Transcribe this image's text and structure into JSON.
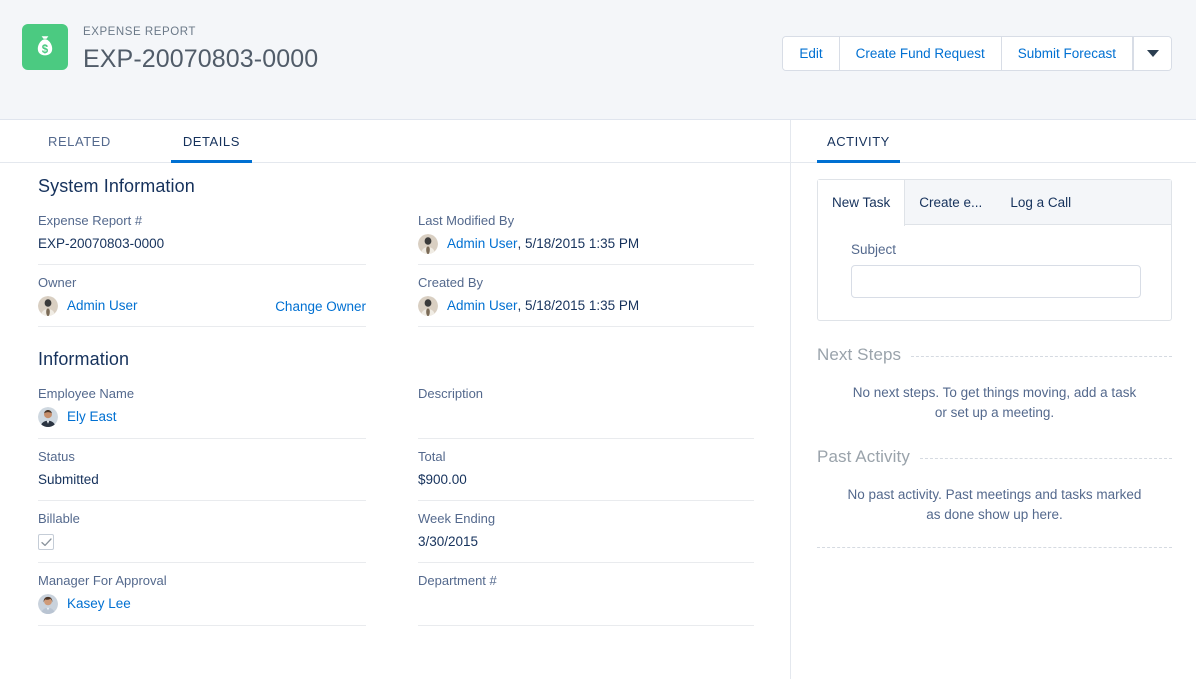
{
  "header": {
    "app_icon": "money-bag-icon",
    "accent_green": "#4bca81",
    "eyebrow": "EXPENSE REPORT",
    "title": "EXP-20070803-0000",
    "actions": [
      "Edit",
      "Create Fund Request",
      "Submit Forecast"
    ],
    "more_actions_icon": "chevron-down-icon"
  },
  "main": {
    "tabs": [
      {
        "label": "RELATED",
        "active": false
      },
      {
        "label": "DETAILS",
        "active": true
      }
    ],
    "system_information": {
      "title": "System Information",
      "left": [
        {
          "label": "Expense Report #",
          "value": "EXP-20070803-0000",
          "type": "text"
        },
        {
          "label": "Owner",
          "value": "Admin User",
          "type": "user-link",
          "avatar": "admin-user-avatar",
          "action_label": "Change Owner"
        }
      ],
      "right": [
        {
          "label": "Last Modified By",
          "value": "Admin User",
          "suffix": ", 5/18/2015 1:35 PM",
          "type": "user-link",
          "avatar": "admin-user-avatar"
        },
        {
          "label": "Created By",
          "value": "Admin User",
          "suffix": ", 5/18/2015 1:35 PM",
          "type": "user-link",
          "avatar": "admin-user-avatar"
        }
      ]
    },
    "information": {
      "title": "Information",
      "left": [
        {
          "label": "Employee Name",
          "value": "Ely East",
          "type": "user-link",
          "avatar": "ely-east-avatar"
        },
        {
          "label": "Status",
          "value": "Submitted",
          "type": "text"
        },
        {
          "label": "Billable",
          "value": "",
          "type": "checkbox",
          "checked": true
        },
        {
          "label": "Manager For Approval",
          "value": "Kasey Lee",
          "type": "user-link",
          "avatar": "kasey-lee-avatar"
        }
      ],
      "right": [
        {
          "label": "Description",
          "value": "",
          "type": "text"
        },
        {
          "label": "Total",
          "value": "$900.00",
          "type": "text"
        },
        {
          "label": "Week Ending",
          "value": "3/30/2015",
          "type": "text"
        },
        {
          "label": "Department #",
          "value": "",
          "type": "text"
        }
      ]
    }
  },
  "activity": {
    "tab_label": "ACTIVITY",
    "composer": {
      "tabs": [
        {
          "label": "New Task",
          "active": true
        },
        {
          "label": "Create e...",
          "active": false
        },
        {
          "label": "Log a Call",
          "active": false
        }
      ],
      "subject_label": "Subject",
      "subject_value": "",
      "subject_placeholder": ""
    },
    "next_steps": {
      "title": "Next Steps",
      "empty_message": "No next steps. To get things moving, add a task or set up a meeting."
    },
    "past_activity": {
      "title": "Past Activity",
      "empty_message": "No past activity. Past meetings and tasks marked as done show up here."
    }
  }
}
